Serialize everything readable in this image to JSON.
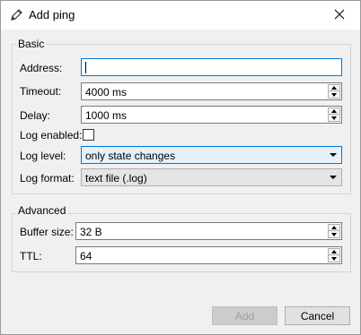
{
  "window": {
    "title": "Add ping",
    "title_icon": "pencil-icon",
    "close_icon": "close-icon"
  },
  "basic": {
    "title": "Basic",
    "address": {
      "label": "Address:",
      "value": ""
    },
    "timeout": {
      "label": "Timeout:",
      "value": "4000 ms"
    },
    "delay": {
      "label": "Delay:",
      "value": "1000 ms"
    },
    "log_enabled": {
      "label": "Log enabled:",
      "checked": false
    },
    "log_level": {
      "label": "Log level:",
      "value": "only state changes"
    },
    "log_format": {
      "label": "Log format:",
      "value": "text file (.log)"
    }
  },
  "advanced": {
    "title": "Advanced",
    "buffer_size": {
      "label": "Buffer size:",
      "value": "32 B"
    },
    "ttl": {
      "label": "TTL:",
      "value": "64"
    }
  },
  "buttons": {
    "add": "Add",
    "cancel": "Cancel"
  },
  "colors": {
    "focus": "#0078d7",
    "dialog_bg": "#f0f0f0",
    "title_bg": "#ffffff"
  }
}
